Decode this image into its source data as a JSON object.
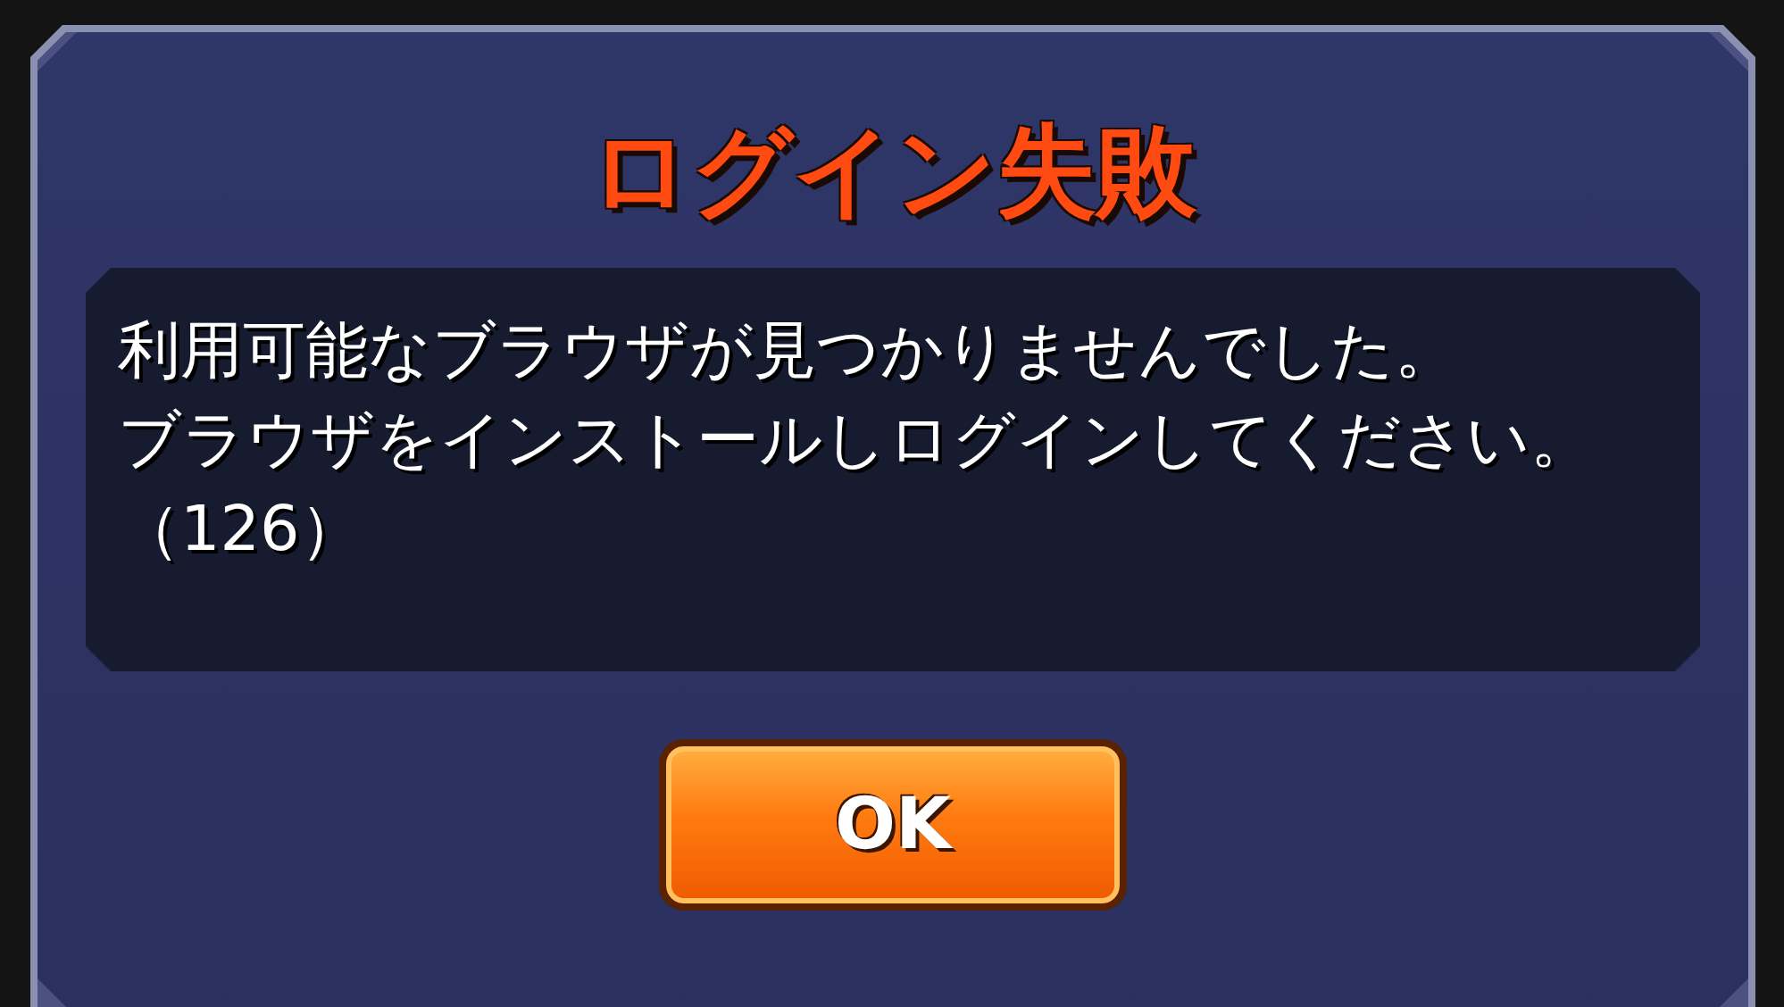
{
  "dialog": {
    "title": "ログイン失敗",
    "message_lines": [
      "利用可能なブラウザが見つかりませんでした。",
      "ブラウザをインストールしログインしてください。",
      "（126）"
    ],
    "buttons": [
      {
        "label": "OK"
      }
    ]
  }
}
